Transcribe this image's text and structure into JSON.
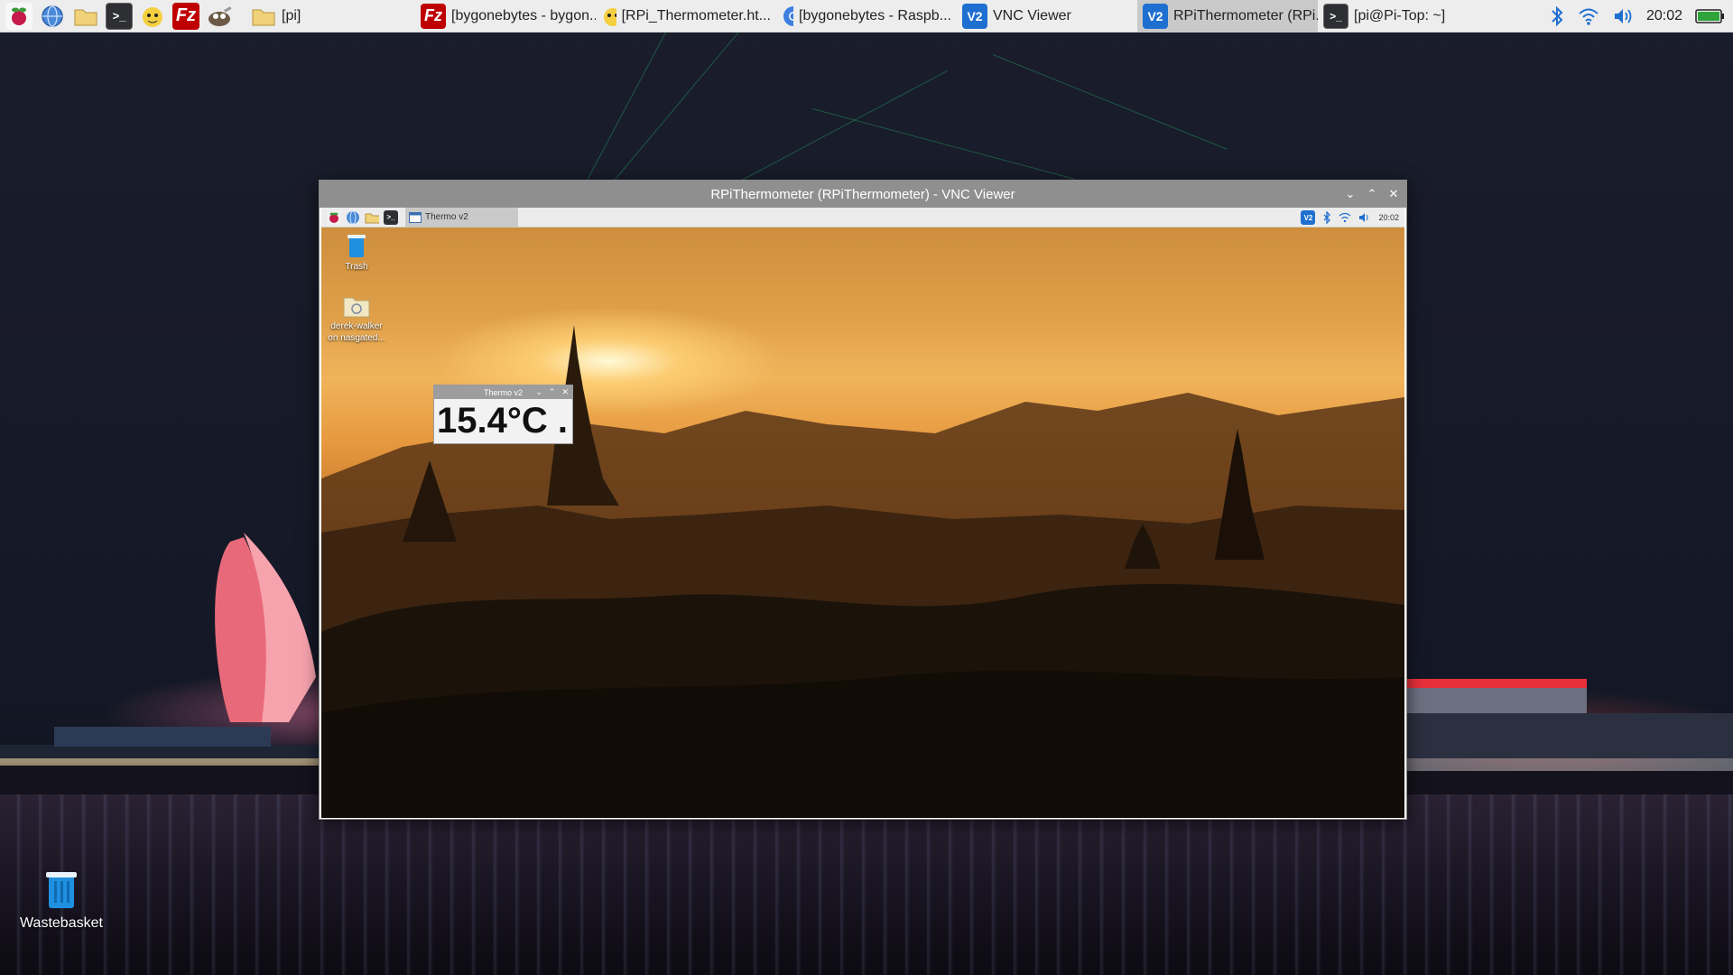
{
  "host_taskbar": {
    "launchers": [
      {
        "icon": "raspberry-menu-icon",
        "color": "#c51a4a"
      },
      {
        "icon": "web-browser-icon",
        "color": "#3b7fd1"
      },
      {
        "icon": "file-manager-icon",
        "color": "#e8c25a"
      },
      {
        "icon": "terminal-icon",
        "color": "#2d2d2d"
      },
      {
        "icon": "mascot-app-icon",
        "color": "#f1c232"
      },
      {
        "icon": "filezilla-icon",
        "color": "#bf0000"
      },
      {
        "icon": "gimp-icon",
        "color": "#6b5a45"
      }
    ],
    "tasks": [
      {
        "label": "[pi]",
        "icon": "folder-icon",
        "active": false
      },
      {
        "label": "[bygonebytes - bygon...",
        "icon": "filezilla-icon",
        "active": false
      },
      {
        "label": "[RPi_Thermometer.ht...",
        "icon": "mascot-app-icon",
        "active": false
      },
      {
        "label": "[bygonebytes - Raspb...",
        "icon": "chromium-icon",
        "active": false
      },
      {
        "label": "VNC Viewer",
        "icon": "vnc-icon",
        "active": false
      },
      {
        "label": "RPiThermometer (RPi...",
        "icon": "vnc-icon",
        "active": true
      },
      {
        "label": "[pi@Pi-Top: ~]",
        "icon": "terminal-icon",
        "active": false
      }
    ],
    "clock": "20:02"
  },
  "host_desktop": {
    "wastebasket_label": "Wastebasket"
  },
  "vnc_window": {
    "title": "RPiThermometer (RPiThermometer) - VNC Viewer"
  },
  "remote": {
    "taskbar": {
      "task_label": "Thermo v2",
      "clock": "20:02"
    },
    "desktop_icons": {
      "trash_label": "Trash",
      "share_label_line1": "derek-walker",
      "share_label_line2": "on nasgated..."
    },
    "thermo_window": {
      "title": "Thermo v2",
      "reading": "15.4°C ."
    }
  }
}
